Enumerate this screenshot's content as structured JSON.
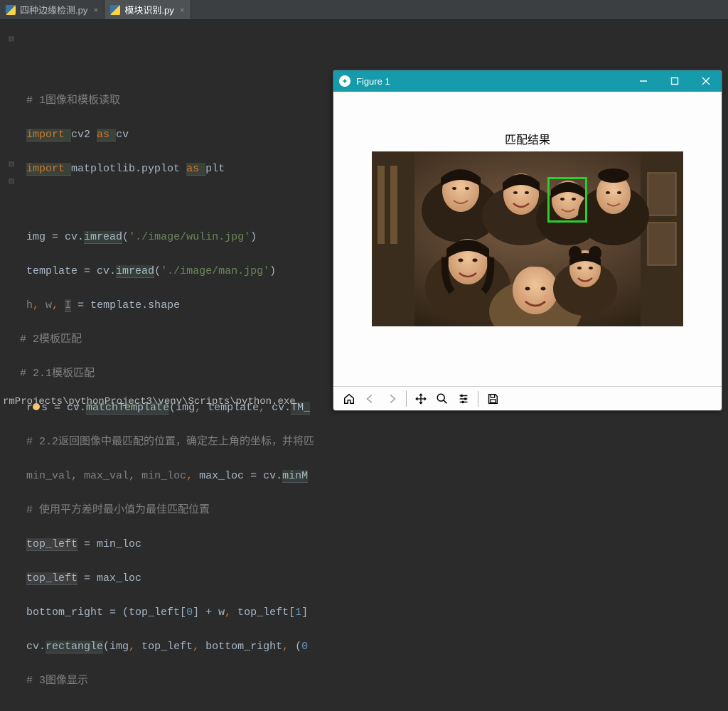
{
  "tabs": [
    {
      "label": "四种边缘检测.py",
      "active": false
    },
    {
      "label": "模块识别.py",
      "active": true
    }
  ],
  "code": {
    "l1_cmt": "# 1图像和模板读取",
    "l2_kw1": "import ",
    "l2_mod": "cv2 ",
    "l2_kw2": "as ",
    "l2_alias": "cv",
    "l3_kw1": "import ",
    "l3_mod": "matplotlib.pyplot ",
    "l3_kw2": "as ",
    "l3_alias": "plt",
    "l5_a": "img = cv.",
    "l5_b": "imread",
    "l5_c": "(",
    "l5_d": "'./image/wulin.jpg'",
    "l5_e": ")",
    "l6_a": "template = cv.",
    "l6_b": "imread",
    "l6_c": "(",
    "l6_d": "'./image/man.jpg'",
    "l6_e": ")",
    "l7_a": "h",
    "l7_b": ", ",
    "l7_c": "w",
    "l7_d": ", ",
    "l7_e": "I",
    "l7_f": " = template.shape",
    "l8_cmt": "# 2模板匹配",
    "l9_cmt": "# 2.1模板匹配",
    "l10_a": "r",
    "l10_b": "s = cv.",
    "l10_c": "matchTemplate",
    "l10_d": "(img",
    "l10_e": ", ",
    "l10_f": "template",
    "l10_g": ", ",
    "l10_h": "cv.",
    "l10_i": "TM_",
    "l11_cmt": "# 2.2返回图像中最匹配的位置，确定左上角的坐标，并将匹",
    "l12_a": "min_val",
    "l12_b": ", ",
    "l12_c": "max_val",
    "l12_d": ", ",
    "l12_e": "min_loc",
    "l12_f": ", ",
    "l12_g": "max_loc = cv.",
    "l12_h": "minM",
    "l13_cmt": "# 使用平方差时最小值为最佳匹配位置",
    "l14_a": "top_left",
    "l14_b": " = min_loc",
    "l15_a": "top_left",
    "l15_b": " = max_loc",
    "l16_a": "bottom_right = (top_left[",
    "l16_b": "0",
    "l16_c": "] + w",
    "l16_d": ", ",
    "l16_e": "top_left[",
    "l16_f": "1",
    "l16_g": "]",
    "l17_a": "cv.",
    "l17_b": "rectangle",
    "l17_c": "(img",
    "l17_d": ", ",
    "l17_e": "top_left",
    "l17_f": ", ",
    "l17_g": "bottom_right",
    "l17_h": ", ",
    "l17_i": "(",
    "l17_j": "0",
    "l18_cmt": "# 3图像显示"
  },
  "terminal": "rmProjects\\pythonProject3\\venv\\Scripts\\python.exe",
  "figure": {
    "title": "Figure 1",
    "plot_title": "匹配结果"
  },
  "toolbar_icons": {
    "home": "home-icon",
    "back": "back-arrow-icon",
    "forward": "forward-arrow-icon",
    "pan": "pan-icon",
    "zoom": "zoom-icon",
    "configure": "configure-icon",
    "save": "save-icon"
  }
}
